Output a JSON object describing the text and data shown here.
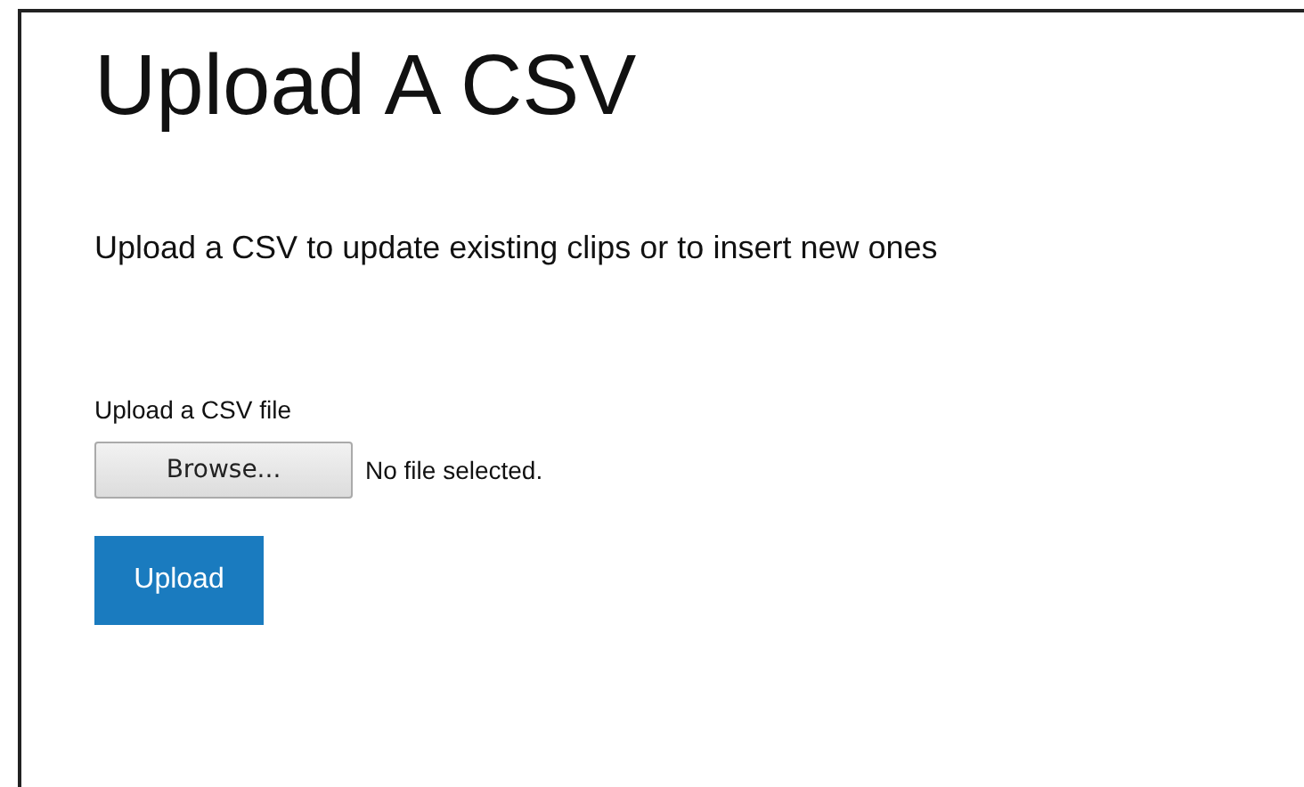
{
  "heading": "Upload A CSV",
  "description": "Upload a CSV to update existing clips or to insert new ones",
  "file_field": {
    "label": "Upload a CSV file",
    "browse_button": "Browse...",
    "status": "No file selected."
  },
  "submit_button": "Upload"
}
